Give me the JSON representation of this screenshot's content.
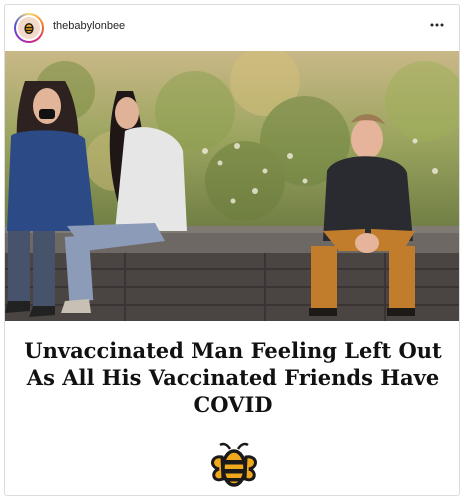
{
  "post": {
    "username": "thebabylonbee",
    "more_icon": "more-horizontal-icon",
    "avatar_icon": "babylon-bee-logo-icon",
    "headline": "Unvaccinated Man Feeling Left Out As All His Vaccinated Friends Have COVID",
    "logo_icon": "babylon-bee-logo-icon"
  },
  "colors": {
    "logo_yellow": "#f0a81c",
    "logo_black": "#1a1a1a",
    "text": "#111111"
  }
}
